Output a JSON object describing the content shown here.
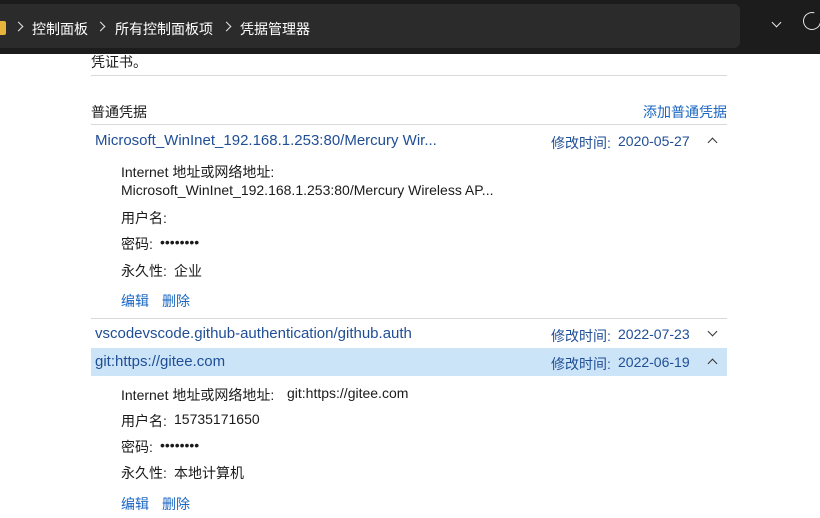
{
  "breadcrumb": {
    "items": [
      "控制面板",
      "所有控制面板项",
      "凭据管理器"
    ]
  },
  "partial_text": "凭证书。",
  "section": {
    "title": "普通凭据",
    "add_link": "添加普通凭据"
  },
  "credentials": [
    {
      "name": "Microsoft_WinInet_192.168.1.253:80/Mercury Wir...",
      "modified_label": "修改时间:",
      "modified_date": "2020-05-27",
      "expanded": true,
      "address_label": "Internet 地址或网络地址:",
      "address_value": "Microsoft_WinInet_192.168.1.253:80/Mercury Wireless AP...",
      "username_label": "用户名:",
      "username_value": "",
      "password_label": "密码:",
      "password_value": "••••••••",
      "persistence_label": "永久性:",
      "persistence_value": "企业",
      "edit_label": "编辑",
      "delete_label": "删除"
    },
    {
      "name": "vscodevscode.github-authentication/github.auth",
      "modified_label": "修改时间:",
      "modified_date": "2022-07-23",
      "expanded": false
    },
    {
      "name": "git:https://gitee.com",
      "modified_label": "修改时间:",
      "modified_date": "2022-06-19",
      "expanded": true,
      "selected": true,
      "address_label": "Internet 地址或网络地址:",
      "address_value": "git:https://gitee.com",
      "username_label": "用户名:",
      "username_value": "15735171650",
      "password_label": "密码:",
      "password_value": "••••••••",
      "persistence_label": "永久性:",
      "persistence_value": "本地计算机",
      "edit_label": "编辑",
      "delete_label": "删除"
    }
  ],
  "colors": {
    "link": "#1a66c2",
    "header_text": "#1f4e96",
    "selected_bg": "#cce4f7",
    "titlebar_bg": "#1c1c1c"
  },
  "icons": [
    "folder-icon",
    "chevron-right-icon",
    "chevron-down-icon",
    "refresh-icon",
    "chevron-up-icon"
  ]
}
